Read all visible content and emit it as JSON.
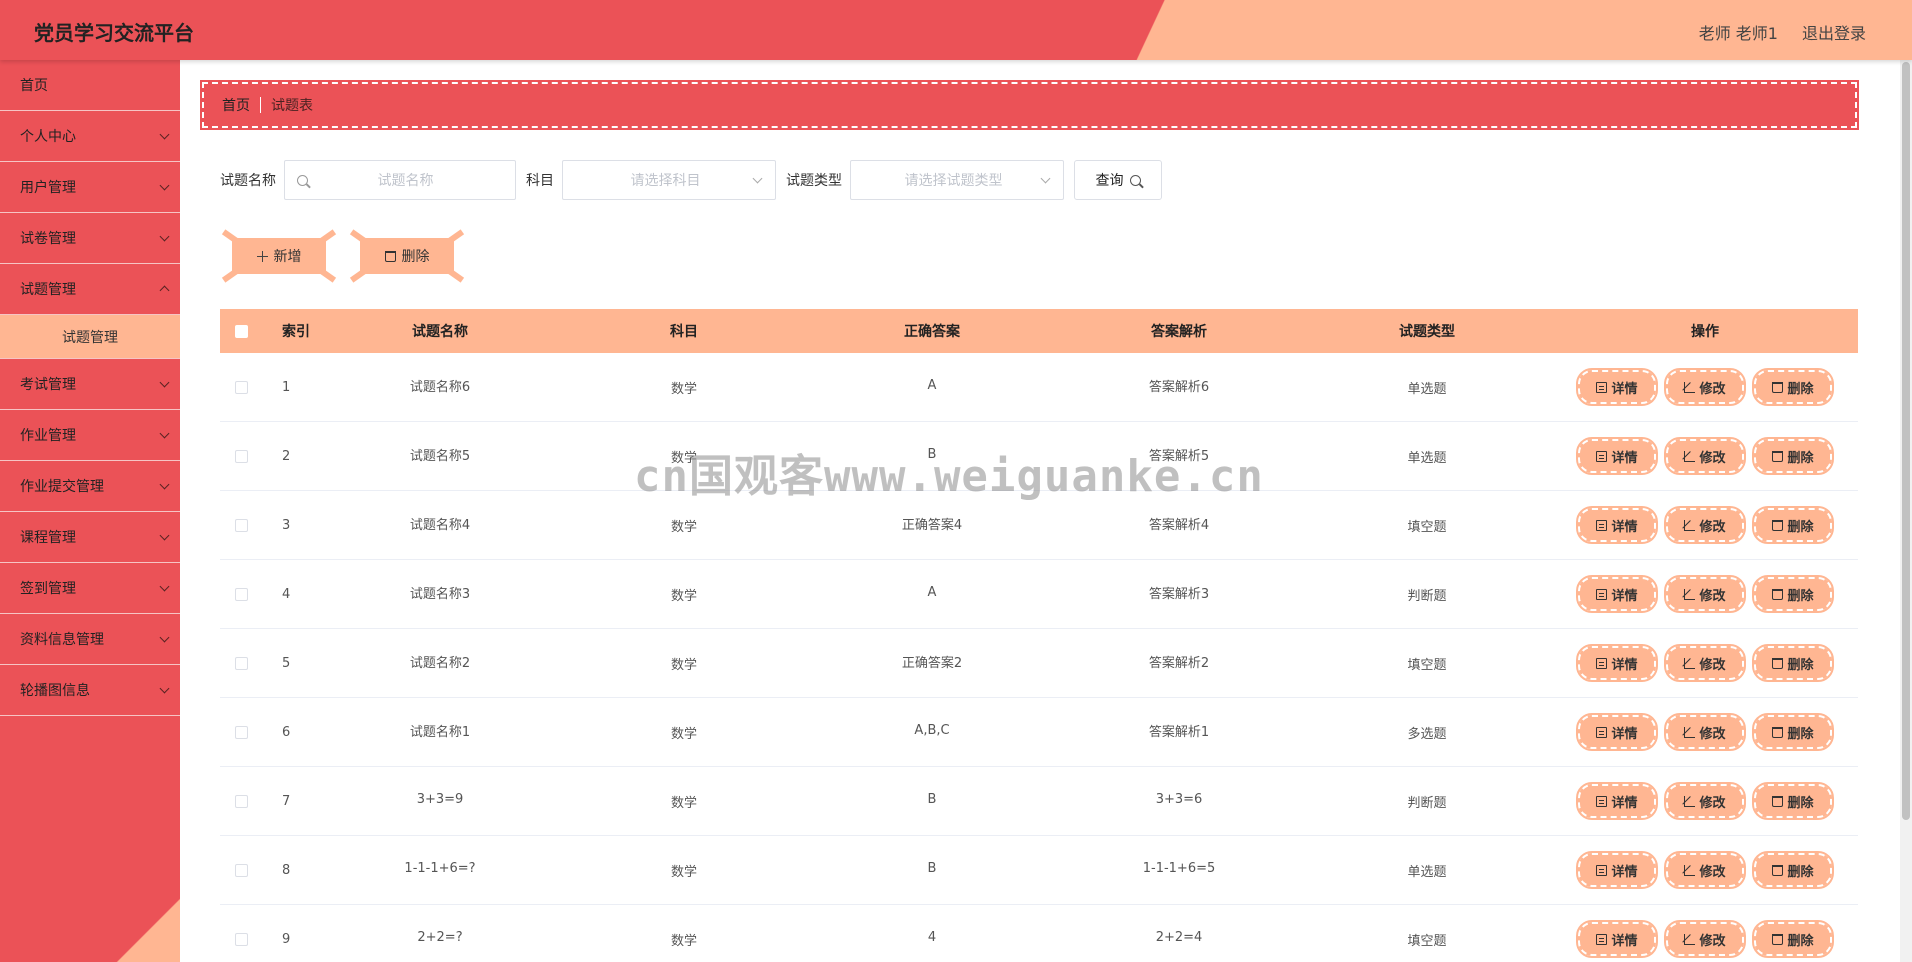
{
  "header": {
    "title": "党员学习交流平台",
    "user": "老师 老师1",
    "logout": "退出登录"
  },
  "sidebar": {
    "items": [
      {
        "label": "首页"
      },
      {
        "label": "个人中心"
      },
      {
        "label": "用户管理"
      },
      {
        "label": "试卷管理"
      },
      {
        "label": "试题管理"
      },
      {
        "label": "考试管理"
      },
      {
        "label": "作业管理"
      },
      {
        "label": "作业提交管理"
      },
      {
        "label": "课程管理"
      },
      {
        "label": "签到管理"
      },
      {
        "label": "资料信息管理"
      },
      {
        "label": "轮播图信息"
      }
    ],
    "active_sub": "试题管理"
  },
  "breadcrumb": {
    "home": "首页",
    "current": "试题表"
  },
  "search": {
    "name_label": "试题名称",
    "name_placeholder": "试题名称",
    "subject_label": "科目",
    "subject_placeholder": "请选择科目",
    "type_label": "试题类型",
    "type_placeholder": "请选择试题类型",
    "query_label": "查询"
  },
  "actions": {
    "add": "新增",
    "delete": "删除"
  },
  "table": {
    "headers": {
      "index": "索引",
      "name": "试题名称",
      "subject": "科目",
      "answer": "正确答案",
      "analysis": "答案解析",
      "type": "试题类型",
      "ops": "操作"
    },
    "ops": {
      "detail": "详情",
      "edit": "修改",
      "delete": "删除"
    },
    "rows": [
      {
        "index": "1",
        "name": "试题名称6",
        "subject": "数学",
        "answer": "A",
        "analysis": "答案解析6",
        "type": "单选题"
      },
      {
        "index": "2",
        "name": "试题名称5",
        "subject": "数学",
        "answer": "B",
        "analysis": "答案解析5",
        "type": "单选题"
      },
      {
        "index": "3",
        "name": "试题名称4",
        "subject": "数学",
        "answer": "正确答案4",
        "analysis": "答案解析4",
        "type": "填空题"
      },
      {
        "index": "4",
        "name": "试题名称3",
        "subject": "数学",
        "answer": "A",
        "analysis": "答案解析3",
        "type": "判断题"
      },
      {
        "index": "5",
        "name": "试题名称2",
        "subject": "数学",
        "answer": "正确答案2",
        "analysis": "答案解析2",
        "type": "填空题"
      },
      {
        "index": "6",
        "name": "试题名称1",
        "subject": "数学",
        "answer": "A,B,C",
        "analysis": "答案解析1",
        "type": "多选题"
      },
      {
        "index": "7",
        "name": "3+3=9",
        "subject": "数学",
        "answer": "B",
        "analysis": "3+3=6",
        "type": "判断题"
      },
      {
        "index": "8",
        "name": "1-1-1+6=?",
        "subject": "数学",
        "answer": "B",
        "analysis": "1-1-1+6=5",
        "type": "单选题"
      },
      {
        "index": "9",
        "name": "2+2=?",
        "subject": "数学",
        "answer": "4",
        "analysis": "2+2=4",
        "type": "填空题"
      }
    ]
  },
  "watermark": "cn国观客www.weiguanke.cn",
  "colors": {
    "primary": "#eb5257",
    "accent": "#ffb692"
  }
}
